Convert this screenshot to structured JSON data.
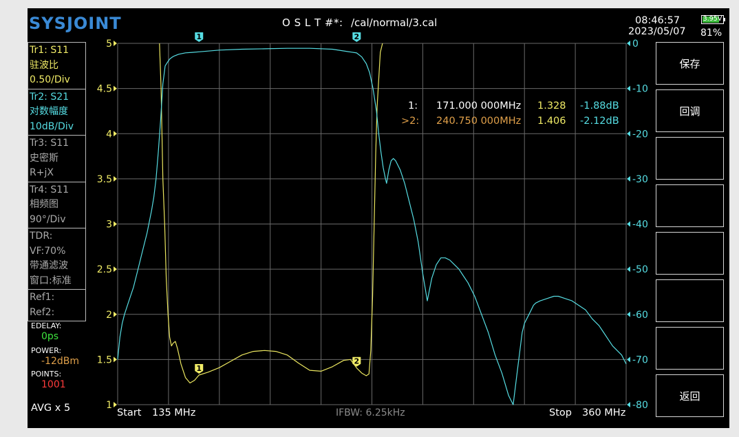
{
  "header": {
    "brand": "SYSJOINT",
    "cal_label": "O S L T #*:",
    "cal_file": "/cal/normal/3.cal",
    "time": "08:46:57",
    "date": "2023/05/07",
    "battery_voltage": "3.95V",
    "battery_percent": "81%"
  },
  "traces": [
    {
      "line1": "Tr1:   S11",
      "line2": "驻波比",
      "line3": "0.50/Div",
      "color": "#f1ec67"
    },
    {
      "line1": "Tr2:   S21",
      "line2": "对数幅度",
      "line3": "10dB/Div",
      "color": "#56dde3"
    },
    {
      "line1": "Tr3:   S11",
      "line2": "史密斯",
      "line3": "R+jX",
      "color": "#aaaaaa"
    },
    {
      "line1": "Tr4:   S11",
      "line2": "相频图",
      "line3": "90°/Div",
      "color": "#aaaaaa"
    }
  ],
  "tdr": {
    "line1": "TDR:",
    "line2": "VF:70%",
    "line3": "带通滤波",
    "line4": "窗口:标准"
  },
  "refs": {
    "ref1": "Ref1:",
    "ref2": "Ref2:"
  },
  "params": {
    "edelay_label": "EDELAY:",
    "edelay_value": "0ps",
    "power_label": "POWER:",
    "power_value": "-12dBm",
    "points_label": "POINTS:",
    "points_value": "1001",
    "avg": "AVG x 5"
  },
  "footer": {
    "start_label": "Start",
    "start_value": "135 MHz",
    "ifbw": "IFBW: 6.25kHz",
    "stop_label": "Stop",
    "stop_value": "360 MHz"
  },
  "softkeys": [
    "保存",
    "回调",
    "",
    "",
    "",
    "",
    "",
    "返回"
  ],
  "markers_table": [
    {
      "id": "1:",
      "freq": "171.000 000MHz",
      "vswr": "1.328",
      "db": "-1.88dB",
      "active": false
    },
    {
      "id": ">2:",
      "freq": "240.750 000MHz",
      "vswr": "1.406",
      "db": "-2.12dB",
      "active": true
    }
  ],
  "chart_data": {
    "type": "line",
    "x_unit": "MHz",
    "xlim": [
      135,
      360
    ],
    "y_left": {
      "ticks": [
        "5",
        "4.5",
        "4",
        "3.5",
        "3",
        "2.5",
        "2",
        "1.5",
        "1"
      ],
      "ylim": [
        1,
        5
      ]
    },
    "y_right": {
      "ticks": [
        "0",
        "-10",
        "-20",
        "-30",
        "-40",
        "-50",
        "-60",
        "-70",
        "-80"
      ],
      "ylim": [
        -80,
        0
      ]
    },
    "grid": true,
    "series": [
      {
        "axis": "left",
        "color": "#ede860",
        "x": [
          153.5,
          154.2,
          155,
          155.8,
          156.5,
          157.3,
          158,
          158.8,
          159.5,
          160.5,
          161.5,
          163,
          165,
          167,
          169,
          171,
          175,
          180,
          185,
          190,
          195,
          200,
          205,
          210,
          215,
          220,
          225,
          230,
          235,
          238,
          240.75,
          243,
          245,
          246.2,
          247,
          247.8,
          248.5,
          249.2,
          249.8,
          250.5,
          251.2,
          252.2
        ],
        "values": [
          5.0,
          4.5,
          3.5,
          3.0,
          2.4,
          2.0,
          1.75,
          1.65,
          1.68,
          1.7,
          1.62,
          1.45,
          1.3,
          1.24,
          1.27,
          1.328,
          1.36,
          1.41,
          1.48,
          1.55,
          1.59,
          1.6,
          1.59,
          1.55,
          1.46,
          1.38,
          1.37,
          1.42,
          1.49,
          1.5,
          1.406,
          1.35,
          1.32,
          1.34,
          1.6,
          2.2,
          3.0,
          3.8,
          4.3,
          4.6,
          4.9,
          5.0
        ]
      },
      {
        "axis": "right",
        "color": "#56dde3",
        "x": [
          135,
          136,
          137,
          138,
          140,
          142,
          144,
          146,
          148,
          150,
          151,
          152,
          153,
          154,
          155,
          156,
          157,
          158,
          159,
          160,
          162,
          165,
          168,
          171,
          175,
          180,
          190,
          200,
          210,
          220,
          230,
          240.75,
          243,
          245,
          246.5,
          248,
          249.5,
          250.5,
          251.5,
          252.5,
          253.5,
          254,
          255,
          256,
          257,
          258,
          260,
          262,
          264,
          266,
          268,
          270,
          272,
          274,
          276,
          278,
          280,
          282,
          284,
          286,
          288,
          290,
          293,
          296,
          299,
          302,
          305,
          308,
          310,
          312,
          314,
          315,
          316,
          317,
          318,
          319,
          320,
          322,
          325,
          328,
          330,
          333,
          336,
          339,
          342,
          345,
          348,
          350,
          352,
          354,
          356,
          358,
          359,
          360
        ],
        "values": [
          -70,
          -65,
          -62,
          -60,
          -57,
          -54,
          -50,
          -46,
          -42,
          -37,
          -34,
          -30,
          -24,
          -17,
          -9,
          -5,
          -4.2,
          -3.5,
          -3.1,
          -2.8,
          -2.4,
          -2.1,
          -2.0,
          -1.88,
          -1.7,
          -1.5,
          -1.3,
          -1.2,
          -1.1,
          -1.1,
          -1.3,
          -2.12,
          -3,
          -4.5,
          -6.5,
          -10,
          -15,
          -20,
          -24,
          -27.5,
          -30,
          -31,
          -28,
          -26,
          -25.5,
          -26,
          -28,
          -31,
          -35,
          -39,
          -44,
          -51,
          -57,
          -52,
          -49,
          -47.5,
          -47.5,
          -48,
          -49,
          -50,
          -51.5,
          -53,
          -56,
          -60,
          -64,
          -69,
          -73,
          -78,
          -80,
          -72,
          -64,
          -62,
          -61,
          -60,
          -59,
          -58,
          -57.5,
          -57,
          -56.5,
          -56,
          -56,
          -56.5,
          -57,
          -58,
          -59,
          -61,
          -62.5,
          -64,
          -65.5,
          -67,
          -68,
          -69,
          -70,
          -71
        ]
      }
    ],
    "markers": [
      {
        "label": "1",
        "x": 171.0,
        "vswr": 1.328,
        "db": -1.88
      },
      {
        "label": "2",
        "x": 240.75,
        "vswr": 1.406,
        "db": -2.12
      }
    ]
  }
}
